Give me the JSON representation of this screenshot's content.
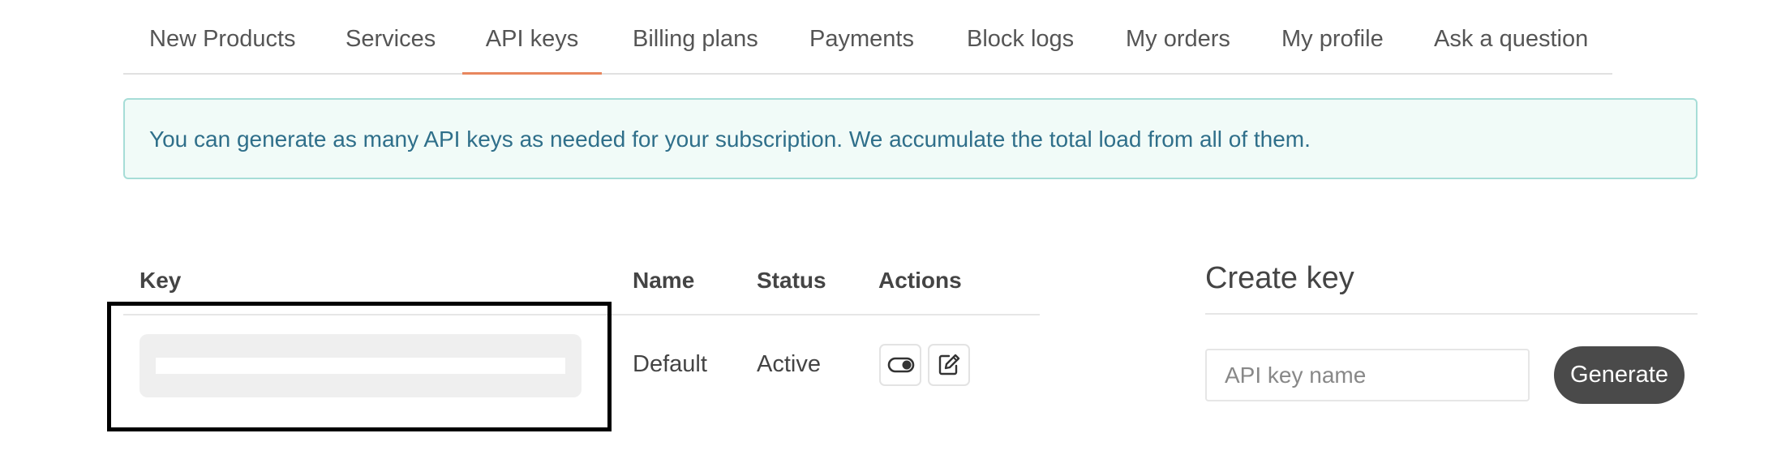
{
  "nav": {
    "tabs": [
      {
        "label": "New Products"
      },
      {
        "label": "Services"
      },
      {
        "label": "API keys",
        "active": true
      },
      {
        "label": "Billing plans"
      },
      {
        "label": "Payments"
      },
      {
        "label": "Block logs"
      },
      {
        "label": "My orders"
      },
      {
        "label": "My profile"
      },
      {
        "label": "Ask a question"
      }
    ]
  },
  "alert": {
    "text": "You can generate as many API keys as needed for your subscription. We accumulate the total load from all of them."
  },
  "keys_table": {
    "headers": {
      "key": "Key",
      "name": "Name",
      "status": "Status",
      "actions": "Actions"
    },
    "rows": [
      {
        "name": "Default",
        "status": "Active",
        "actions": [
          "toggle-icon",
          "edit-icon"
        ]
      }
    ]
  },
  "create_key": {
    "title": "Create key",
    "input_placeholder": "API key name",
    "button_label": "Generate"
  },
  "colors": {
    "active_tab_underline": "#e8875e",
    "alert_background": "#f1fbf8",
    "alert_border": "#a6ddd7",
    "alert_text": "#2f6f8a",
    "generate_button": "#4a4a4a"
  }
}
